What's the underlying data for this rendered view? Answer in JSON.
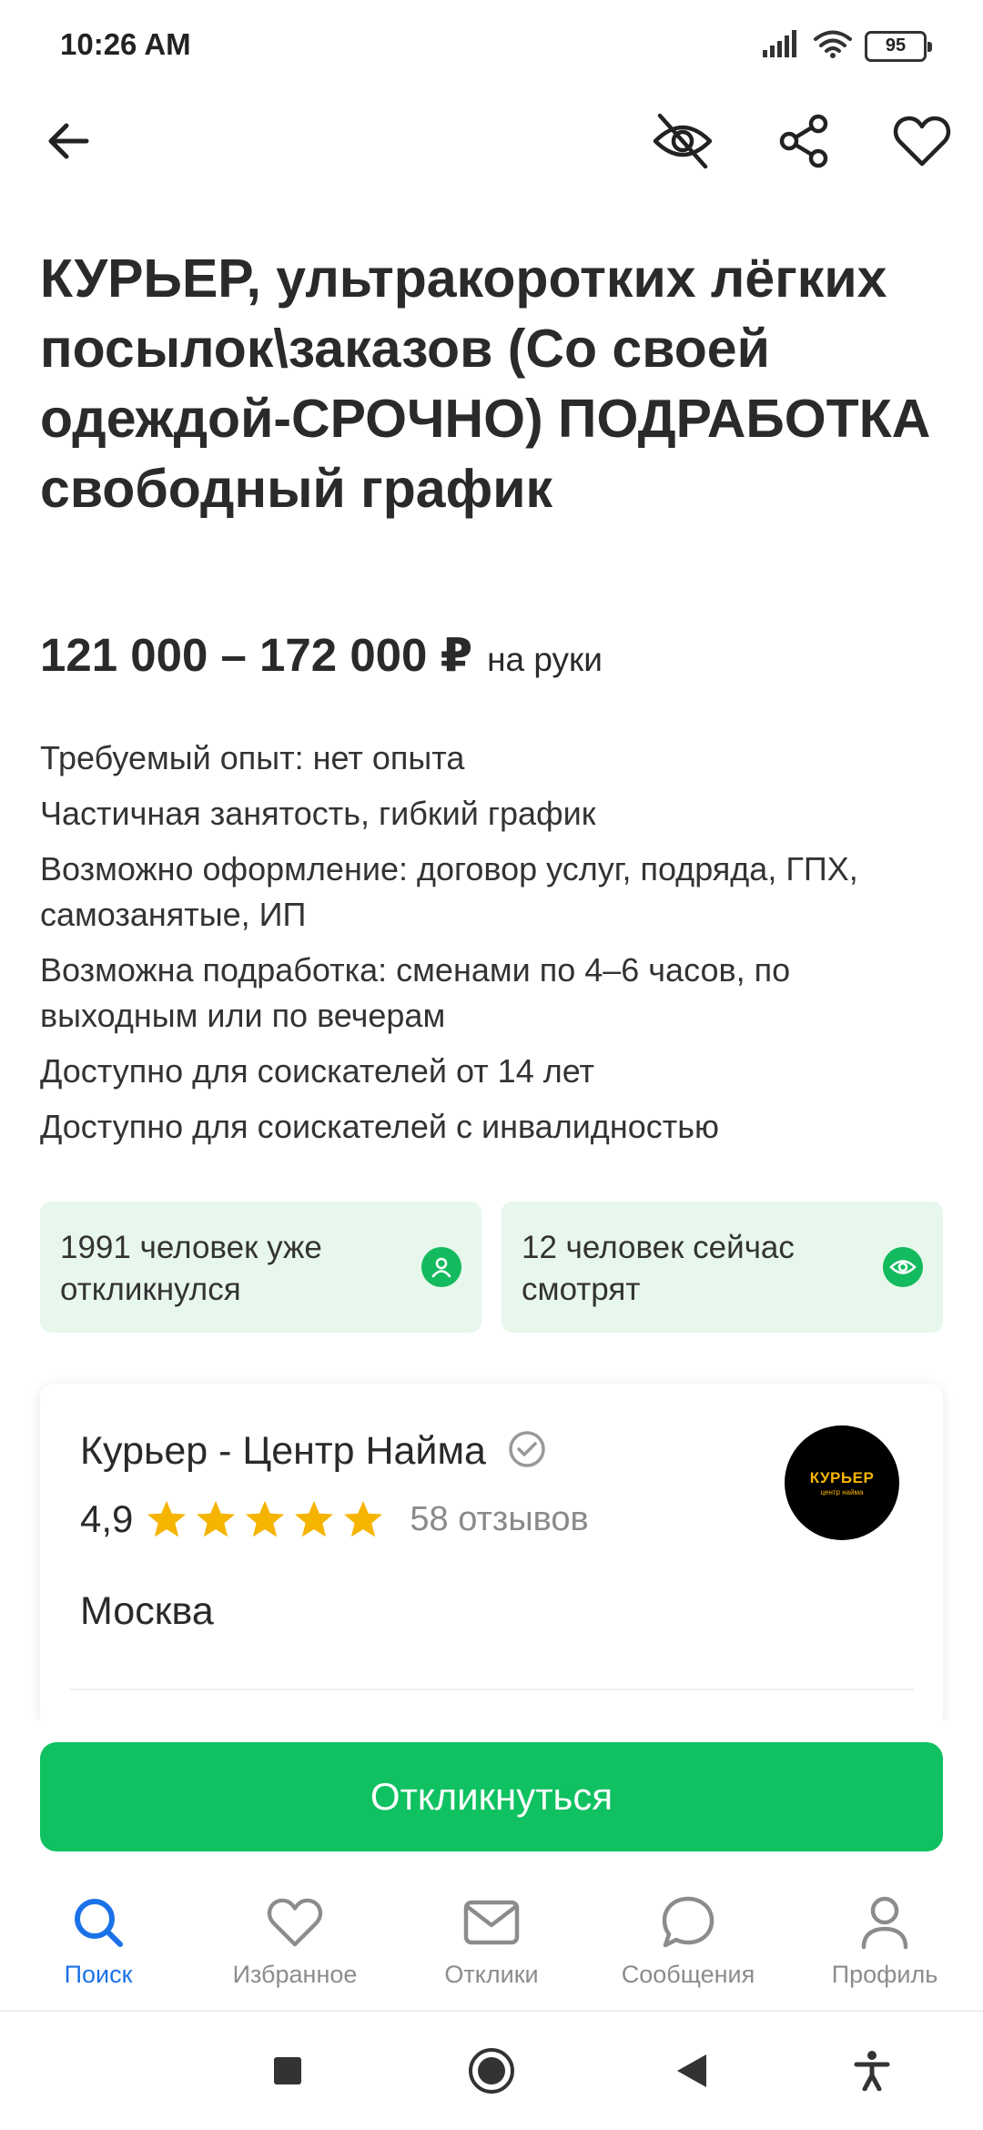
{
  "status_bar": {
    "time": "10:26 AM",
    "battery": "95"
  },
  "vacancy": {
    "title": "КУРЬЕР, ультракоротких лёгких посылок\\заказов (Со своей одеждой-СРОЧНО) ПОДРАБОТКА свободный график",
    "salary": "121 000 – 172 000 ₽",
    "salary_note": "на руки",
    "details": [
      "Требуемый опыт: нет опыта",
      "Частичная занятость, гибкий график",
      "Возможно оформление: договор услуг, подряда, ГПХ, самозанятые, ИП",
      "Возможна подработка: сменами по 4–6 часов, по выходным или по вечерам",
      "Доступно для соискателей от 14 лет",
      "Доступно для соискателей с инвалидностью"
    ]
  },
  "stats": {
    "responded": "1991 человек уже откликнулся",
    "viewing": "12 человек сейчас смотрят"
  },
  "company": {
    "name": "Курьер - Центр Найма",
    "rating": "4,9",
    "stars": 5,
    "reviews": "58 отзывов",
    "city": "Москва",
    "logo_main": "КУРЬЕР",
    "logo_sub": "центр найма"
  },
  "cta": {
    "label": "Откликнуться"
  },
  "bottom_nav": [
    {
      "label": "Поиск",
      "icon": "search-icon",
      "active": true
    },
    {
      "label": "Избранное",
      "icon": "heart-icon",
      "active": false
    },
    {
      "label": "Отклики",
      "icon": "envelope-icon",
      "active": false
    },
    {
      "label": "Сообщения",
      "icon": "chat-bubble-icon",
      "active": false
    },
    {
      "label": "Профиль",
      "icon": "person-icon",
      "active": false
    }
  ],
  "colors": {
    "accent_green": "#0fc160",
    "stat_bg": "#e8f7ec",
    "nav_active": "#1b72e8",
    "nav_inactive": "#8c8c8c",
    "star": "#f5b400"
  }
}
